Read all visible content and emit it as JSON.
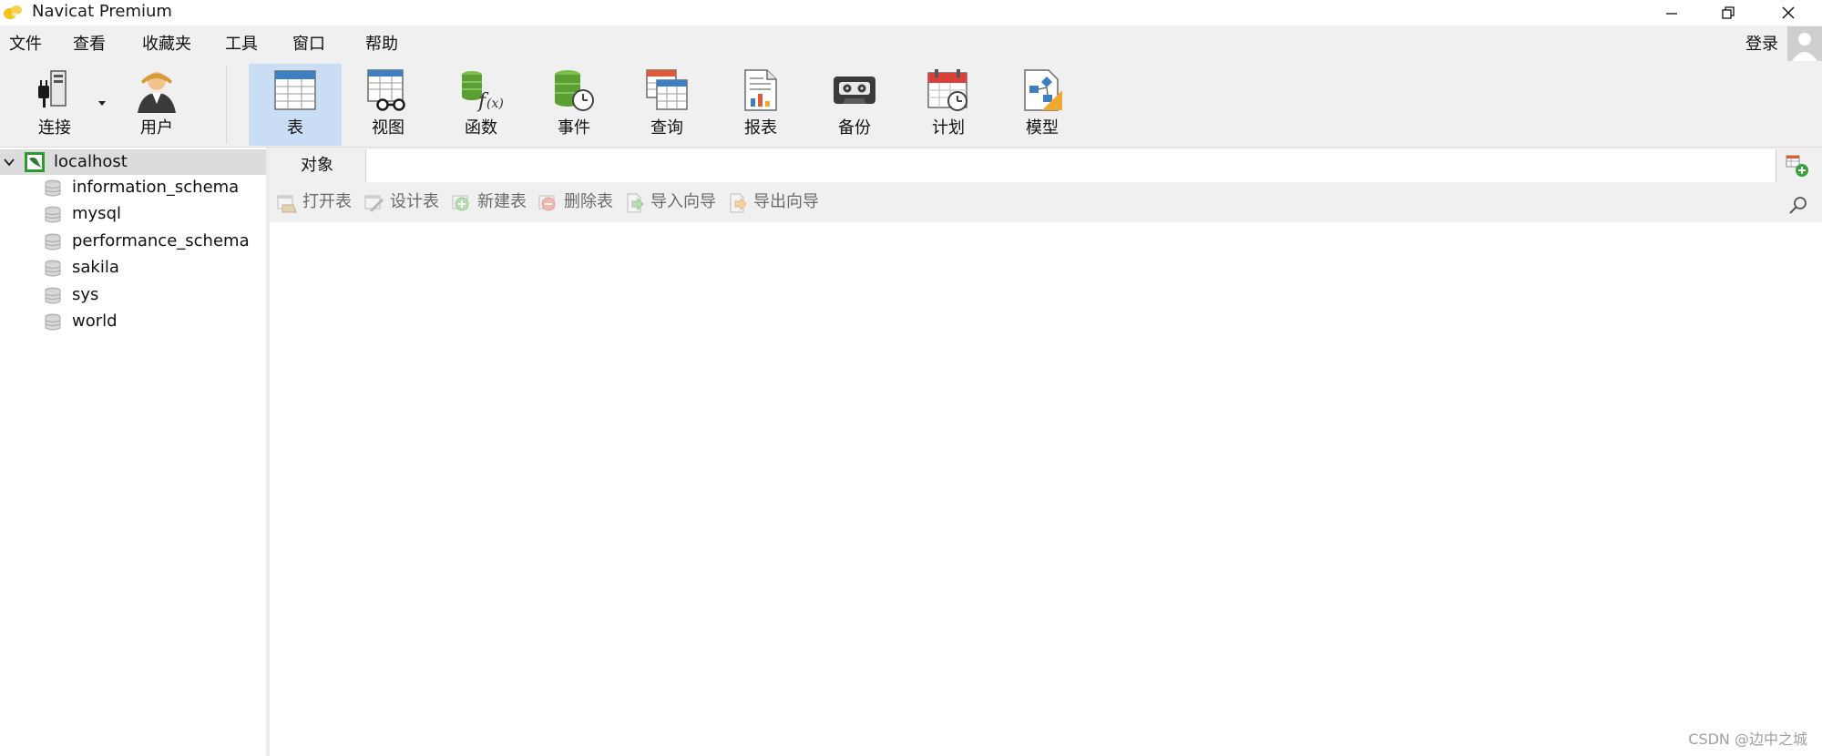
{
  "window": {
    "title": "Navicat Premium"
  },
  "menu": {
    "items": [
      "文件",
      "查看",
      "收藏夹",
      "工具",
      "窗口",
      "帮助"
    ],
    "login": "登录"
  },
  "toolbar": {
    "items": [
      {
        "label": "连接",
        "icon": "connection-icon"
      },
      {
        "label": "用户",
        "icon": "user-icon"
      },
      {
        "label": "表",
        "icon": "table-icon"
      },
      {
        "label": "视图",
        "icon": "view-icon"
      },
      {
        "label": "函数",
        "icon": "function-icon"
      },
      {
        "label": "事件",
        "icon": "event-icon"
      },
      {
        "label": "查询",
        "icon": "query-icon"
      },
      {
        "label": "报表",
        "icon": "report-icon"
      },
      {
        "label": "备份",
        "icon": "backup-icon"
      },
      {
        "label": "计划",
        "icon": "schedule-icon"
      },
      {
        "label": "模型",
        "icon": "model-icon"
      }
    ],
    "active": "表"
  },
  "tree": {
    "connection": "localhost",
    "databases": [
      "information_schema",
      "mysql",
      "performance_schema",
      "sakila",
      "sys",
      "world"
    ]
  },
  "objects_tab": {
    "label": "对象"
  },
  "object_toolbar": {
    "buttons": [
      "打开表",
      "设计表",
      "新建表",
      "删除表",
      "导入向导",
      "导出向导"
    ]
  },
  "watermark": "CSDN @边中之城",
  "colors": {
    "active_tool": "#c9def5",
    "chrome": "#f0f0f0",
    "tree_selected": "#dcdcdc"
  }
}
